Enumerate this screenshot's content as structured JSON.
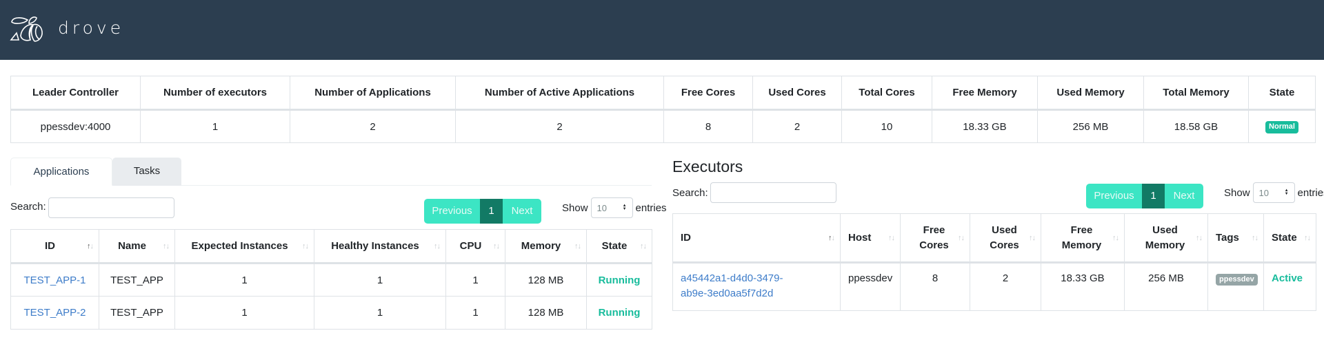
{
  "header": {
    "brand": "drove",
    "logo_icon": "bee-logo-icon"
  },
  "summary": {
    "columns": [
      "Leader Controller",
      "Number of executors",
      "Number of Applications",
      "Number of Active Applications",
      "Free Cores",
      "Used Cores",
      "Total Cores",
      "Free Memory",
      "Used Memory",
      "Total Memory",
      "State"
    ],
    "row": {
      "leader": "ppessdev:4000",
      "executors": "1",
      "applications": "2",
      "active_applications": "2",
      "free_cores": "8",
      "used_cores": "2",
      "total_cores": "10",
      "free_memory": "18.33 GB",
      "used_memory": "256 MB",
      "total_memory": "18.58 GB",
      "state": "Normal"
    },
    "state_color": "#18bc9c"
  },
  "tabs": [
    {
      "label": "Applications",
      "active": true
    },
    {
      "label": "Tasks",
      "active": false
    }
  ],
  "applications": {
    "search_label": "Search:",
    "search_value": "",
    "pagination": {
      "previous": "Previous",
      "page": "1",
      "next": "Next"
    },
    "show_label": "Show",
    "page_size": "10",
    "entries_label": "entries",
    "columns": [
      "ID",
      "Name",
      "Expected Instances",
      "Healthy Instances",
      "CPU",
      "Memory",
      "State"
    ],
    "sorted_column": "ID",
    "sort_direction": "ascending",
    "rows": [
      {
        "id": "TEST_APP-1",
        "name": "TEST_APP",
        "expected": "1",
        "healthy": "1",
        "cpu": "1",
        "memory": "128 MB",
        "state": "Running"
      },
      {
        "id": "TEST_APP-2",
        "name": "TEST_APP",
        "expected": "1",
        "healthy": "1",
        "cpu": "1",
        "memory": "128 MB",
        "state": "Running"
      }
    ]
  },
  "executors": {
    "title": "Executors",
    "search_label": "Search:",
    "search_value": "",
    "pagination": {
      "previous": "Previous",
      "page": "1",
      "next": "Next"
    },
    "show_label": "Show",
    "page_size": "10",
    "entries_label": "entries",
    "columns": [
      {
        "line1": "",
        "line2": "ID"
      },
      {
        "line1": "",
        "line2": "Host"
      },
      {
        "line1": "Free",
        "line2": "Cores"
      },
      {
        "line1": "Used",
        "line2": "Cores"
      },
      {
        "line1": "Free",
        "line2": "Memory"
      },
      {
        "line1": "Used",
        "line2": "Memory"
      },
      {
        "line1": "",
        "line2": "Tags"
      },
      {
        "line1": "",
        "line2": "State"
      }
    ],
    "rows": [
      {
        "id_line1": "a45442a1-d4d0-3479-",
        "id_line2": "ab9e-3ed0aa5f7d2d",
        "host": "ppessdev",
        "free_cores": "8",
        "used_cores": "2",
        "free_memory": "18.33 GB",
        "used_memory": "256 MB",
        "tag": "ppessdev",
        "state": "Active"
      }
    ]
  },
  "colors": {
    "navbar": "#2c3e50",
    "accent": "#18bc9c",
    "pager": "#3ce5c4",
    "pager_active": "#127a65",
    "link": "#3d7cc9"
  }
}
